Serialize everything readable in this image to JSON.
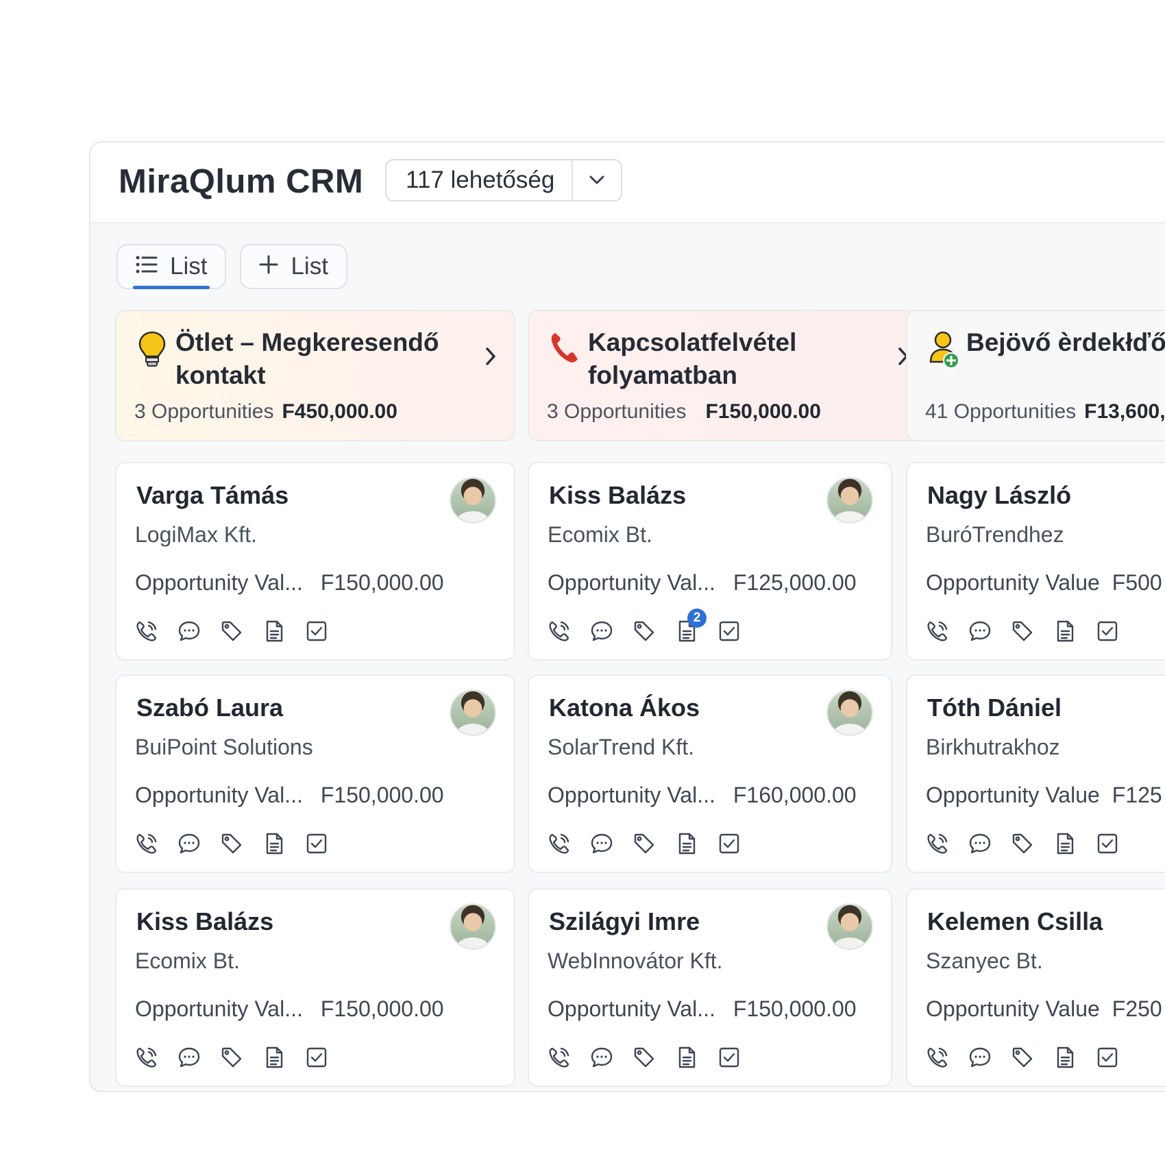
{
  "header": {
    "app_title": "MiraQlum CRM",
    "opportunity_select": "117 lehetőség"
  },
  "tabs": [
    {
      "label": "List",
      "icon": "list-icon",
      "active": true
    },
    {
      "label": "List",
      "icon": "plus-icon",
      "active": false
    }
  ],
  "colors": {
    "accent": "#2f74d0",
    "badge": "#2f6fd6",
    "stage1_bg": "#fdf6ef",
    "stage2_bg": "#fdf0ef",
    "stage3_bg": "#f8f8f9"
  },
  "columns": [
    {
      "stage": {
        "icon": "lightbulb-icon",
        "title": "Ötlet – Megkeresendő kontakt",
        "count": "3 Opportunities",
        "amount": "F450,000.00"
      },
      "cards": [
        {
          "name": "Varga Támás",
          "company": "LogiMax Kft.",
          "value_label": "Opportunity Val...",
          "value": "F150,000.00",
          "badge": null
        },
        {
          "name": "Szabó Laura",
          "company": "BuiPoint Solutions",
          "value_label": "Opportunity Val...",
          "value": "F150,000.00",
          "badge": null
        },
        {
          "name": "Kiss Balázs",
          "company": "Ecomix Bt.",
          "value_label": "Opportunity Val...",
          "value": "F150,000.00",
          "badge": null
        }
      ]
    },
    {
      "stage": {
        "icon": "phone-icon",
        "title": "Kapcsolatfelvétel folyamatban",
        "count": "3 Opportunities",
        "amount": "F150,000.00"
      },
      "cards": [
        {
          "name": "Kiss Balázs",
          "company": "Ecomix Bt.",
          "value_label": "Opportunity Val...",
          "value": "F125,000.00",
          "badge": "2"
        },
        {
          "name": "Katona Ákos",
          "company": "SolarTrend Kft.",
          "value_label": "Opportunity Val...",
          "value": "F160,000.00",
          "badge": null
        },
        {
          "name": "Szilágyi Imre",
          "company": "WebInnovátor Kft.",
          "value_label": "Opportunity Val...",
          "value": "F150,000.00",
          "badge": null
        }
      ]
    },
    {
      "stage": {
        "icon": "user-add-icon",
        "title": "Bejövő èrdekłďő – Megkeresett mir",
        "count": "41 Opportunities",
        "amount": "F13,600,"
      },
      "cards": [
        {
          "name": "Nagy László",
          "company": "BuróTrendhez",
          "value_label": "Opportunity Value",
          "value": "F500",
          "badge": null
        },
        {
          "name": "Tóth Dániel",
          "company": "Birkhutrakhoz",
          "value_label": "Opportunity Value",
          "value": "F125",
          "badge": null
        },
        {
          "name": "Kelemen Csilla",
          "company": "Szanyec Bt.",
          "value_label": "Opportunity Value",
          "value": "F250",
          "badge": null
        }
      ]
    }
  ]
}
